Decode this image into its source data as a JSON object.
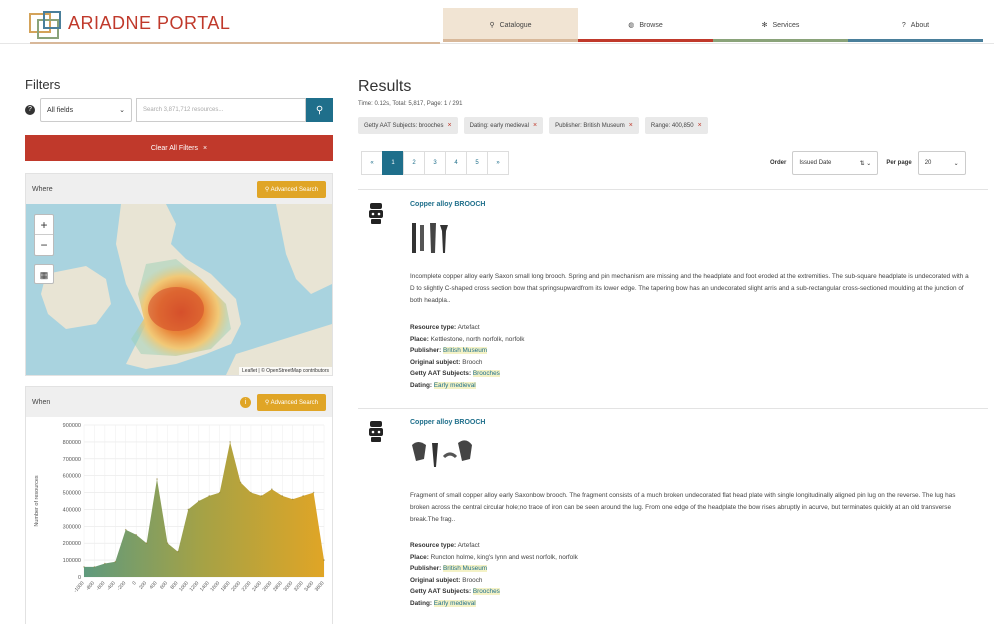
{
  "header": {
    "logo_text": "ARIADNE PORTAL",
    "nav": [
      {
        "label": "Catalogue",
        "icon": "search-icon",
        "glyph": "⚲",
        "color": "#d8b89a"
      },
      {
        "label": "Browse",
        "icon": "globe-icon",
        "glyph": "◍",
        "color": "#c0392b"
      },
      {
        "label": "Services",
        "icon": "gear-icon",
        "glyph": "✻",
        "color": "#8aa37a"
      },
      {
        "label": "About",
        "icon": "question-icon",
        "glyph": "?",
        "color": "#4a7f9b"
      }
    ]
  },
  "filters": {
    "title": "Filters",
    "fields_select": "All fields",
    "search_placeholder": "Search 3,871,712 resources...",
    "clear_label": "Clear All Filters",
    "where": {
      "title": "Where",
      "advanced_label": "Advanced Search",
      "attribution": "Leaflet | © OpenStreetMap contributors"
    },
    "when": {
      "title": "When",
      "advanced_label": "Advanced Search"
    }
  },
  "chart_data": {
    "type": "area",
    "title": "",
    "xlabel": "",
    "ylabel": "Number of resources",
    "ylim": [
      0,
      900000
    ],
    "yticks": [
      0,
      100000,
      200000,
      300000,
      400000,
      500000,
      600000,
      700000,
      800000,
      900000
    ],
    "categories": [
      "-1000",
      "-800",
      "-600",
      "-400",
      "-200",
      "0",
      "200",
      "400",
      "600",
      "800",
      "1000",
      "1200",
      "1400",
      "1600",
      "1800",
      "2000",
      "2200",
      "2400",
      "2600",
      "2800",
      "3000",
      "3200",
      "3400",
      "3600"
    ],
    "values": [
      60000,
      60000,
      80000,
      90000,
      280000,
      250000,
      200000,
      580000,
      200000,
      150000,
      400000,
      450000,
      480000,
      500000,
      800000,
      560000,
      500000,
      480000,
      520000,
      480000,
      460000,
      480000,
      500000,
      100000
    ],
    "grid": true
  },
  "results": {
    "title": "Results",
    "meta": "Time: 0.12s, Total: 5,817, Page: 1 / 291",
    "chips": [
      "Getty AAT Subjects: brooches",
      "Dating: early medieval",
      "Publisher: British Museum",
      "Range: 400,850"
    ],
    "pager": [
      "«",
      "1",
      "2",
      "3",
      "4",
      "5",
      "»"
    ],
    "order_label": "Order",
    "order_value": "Issued Date",
    "per_page_label": "Per page",
    "per_page_value": "20",
    "items": [
      {
        "title": "Copper alloy BROOCH",
        "description": "Incomplete copper alloy early Saxon small long brooch. Spring and pin mechanism are missing and the headplate and foot eroded at the extremities. The sub-square headplate is undecorated with a D to slightly C-shaped cross section bow that springsupwardfrom its lower edge. The tapering bow has an undecorated slight arris and a sub-rectangular cross-sectioned moulding at the junction of both headpla..",
        "resource_type_label": "Resource type:",
        "resource_type": "Artefact",
        "place_label": "Place:",
        "place": "Kettlestone, north norfolk, norfolk",
        "publisher_label": "Publisher:",
        "publisher": "British Museum",
        "original_subject_label": "Original subject:",
        "original_subject": "Brooch",
        "aat_label": "Getty AAT Subjects:",
        "aat": "Brooches",
        "dating_label": "Dating:",
        "dating": "Early medieval"
      },
      {
        "title": "Copper alloy BROOCH",
        "description": "Fragment of small copper alloy early Saxonbow brooch. The fragment consists of a much broken undecorated flat head plate with single longitudinally aligned pin lug on the reverse. The lug has broken across the central circular hole;no trace of iron can be seen around the lug. From one edge of the headplate the bow rises abruptly in acurve, but terminates quickly at an old transverse break.The frag..",
        "resource_type_label": "Resource type:",
        "resource_type": "Artefact",
        "place_label": "Place:",
        "place": "Runcton holme, king's lynn and west norfolk, norfolk",
        "publisher_label": "Publisher:",
        "publisher": "British Museum",
        "original_subject_label": "Original subject:",
        "original_subject": "Brooch",
        "aat_label": "Getty AAT Subjects:",
        "aat": "Brooches",
        "dating_label": "Dating:",
        "dating": "Early medieval"
      }
    ]
  }
}
